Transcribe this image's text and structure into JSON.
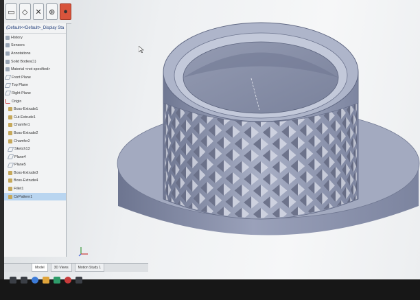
{
  "window": {
    "config_title": "(Default<<Default>_Display Sta"
  },
  "toolbar": {
    "icons": [
      "sketch-icon",
      "smart-dimension-icon",
      "trim-icon",
      "origin-icon",
      "appearance-icon",
      "more-icon"
    ]
  },
  "feature_tree": {
    "items": [
      {
        "label": "History",
        "icon": "history-icon"
      },
      {
        "label": "Sensors",
        "icon": "sensor-icon"
      },
      {
        "label": "Annotations",
        "icon": "annotation-icon"
      },
      {
        "label": "Solid Bodies(1)",
        "icon": "solid-body-icon"
      },
      {
        "label": "Material <not specified>",
        "icon": "material-icon"
      },
      {
        "label": "Front Plane",
        "icon": "plane-icon"
      },
      {
        "label": "Top Plane",
        "icon": "plane-icon"
      },
      {
        "label": "Right Plane",
        "icon": "plane-icon"
      },
      {
        "label": "Origin",
        "icon": "origin-icon"
      },
      {
        "label": "Boss-Extrude1",
        "icon": "feature-icon"
      },
      {
        "label": "Cut-Extrude1",
        "icon": "feature-icon"
      },
      {
        "label": "Chamfer1",
        "icon": "feature-icon"
      },
      {
        "label": "Boss-Extrude2",
        "icon": "feature-icon"
      },
      {
        "label": "Chamfer2",
        "icon": "feature-icon"
      },
      {
        "label": "Sketch13",
        "icon": "sketch-icon"
      },
      {
        "label": "Plane4",
        "icon": "plane-icon"
      },
      {
        "label": "Plane5",
        "icon": "plane-icon"
      },
      {
        "label": "Boss-Extrude3",
        "icon": "feature-icon"
      },
      {
        "label": "Boss-Extrude4",
        "icon": "feature-icon"
      },
      {
        "label": "Fillet1",
        "icon": "feature-icon"
      },
      {
        "label": "CirPattern1",
        "icon": "pattern-icon"
      }
    ]
  },
  "bottom_tabs": [
    {
      "label": "Model"
    },
    {
      "label": "3D Views"
    },
    {
      "label": "Motion Study 1"
    }
  ],
  "colors": {
    "part_face": "#8f97b0",
    "part_dark": "#5f6782",
    "part_light": "#b8bfd3",
    "selection": "#b9d5f0"
  }
}
